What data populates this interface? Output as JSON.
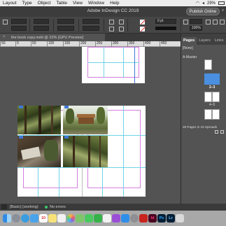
{
  "menubar": {
    "items": [
      "Layout",
      "Type",
      "Object",
      "Table",
      "View",
      "Window",
      "Help"
    ],
    "battery": "29%"
  },
  "titlebar": {
    "title": "Adobe InDesign CC 2019",
    "publish_label": "Publish Online"
  },
  "controlbar": {
    "stroke_weight": "0 pt",
    "zoom": "100%"
  },
  "document_tab": {
    "close_glyph": "×",
    "label": "the book copy.indd @ 22% [GPU Preview]"
  },
  "ruler": {
    "ticks": [
      "50",
      "0",
      "50",
      "100",
      "150",
      "200",
      "250",
      "300",
      "350",
      "400",
      "450"
    ]
  },
  "pages_panel": {
    "tabs": [
      "Pages",
      "Layers",
      "Links"
    ],
    "none_label": "[None]",
    "master_label": "A-Master",
    "spread_labels": [
      "2–3",
      "4–5"
    ],
    "summary": "28 Pages in 15 Spreads"
  },
  "statusbar": {
    "style": "[Basic] (working)",
    "errors": "No errors"
  },
  "dock": {
    "calendar_day": "10",
    "apps": [
      "Finder",
      "Launchpad",
      "Safari",
      "Mail",
      "Calendar",
      "Notes",
      "Reminders",
      "Photos",
      "Maps",
      "Messages",
      "FaceTime",
      "Music",
      "Podcasts",
      "App Store",
      "System Preferences",
      "Acrobat",
      "InDesign",
      "Photoshop",
      "Lightroom",
      "Trash"
    ]
  },
  "colors": {
    "accent": "#4a8fe0",
    "margin_guide": "#d67de0",
    "column_guide": "#6fd3e8",
    "status_ok": "#3cc96c"
  }
}
